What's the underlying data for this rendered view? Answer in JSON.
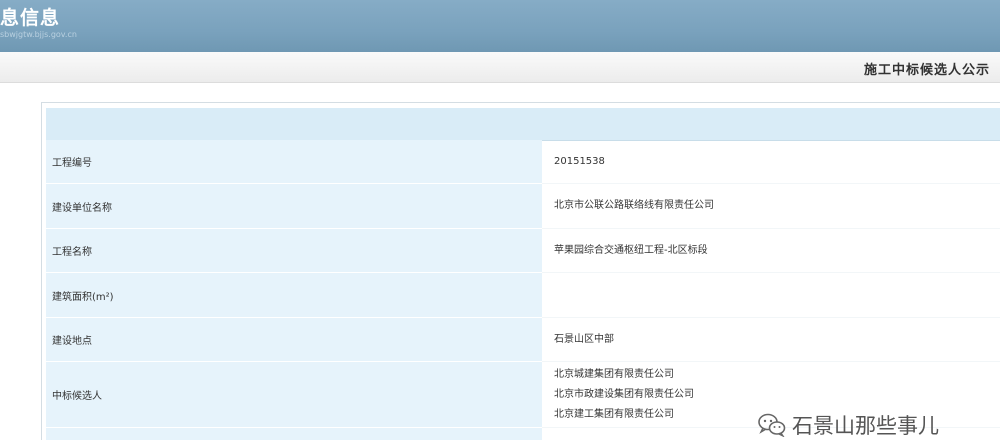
{
  "header": {
    "title": "息信息",
    "subtitle": "sbwjgtw.bjjs.gov.cn"
  },
  "page_heading": "施工中标候选人公示",
  "fields": [
    {
      "label": "工程编号",
      "value": "20151538"
    },
    {
      "label": "建设单位名称",
      "value": "北京市公联公路联络线有限责任公司"
    },
    {
      "label": "工程名称",
      "value": "苹果园综合交通枢纽工程-北区标段"
    },
    {
      "label": "建筑面积(m²)",
      "value": ""
    },
    {
      "label": "建设地点",
      "value": "石景山区中部"
    }
  ],
  "candidates": {
    "label": "中标候选人",
    "values": [
      "北京城建集团有限责任公司",
      "北京市政建设集团有限责任公司",
      "北京建工集团有限责任公司"
    ]
  },
  "watermark": {
    "text": "石景山那些事儿",
    "icon": "wechat-icon"
  }
}
